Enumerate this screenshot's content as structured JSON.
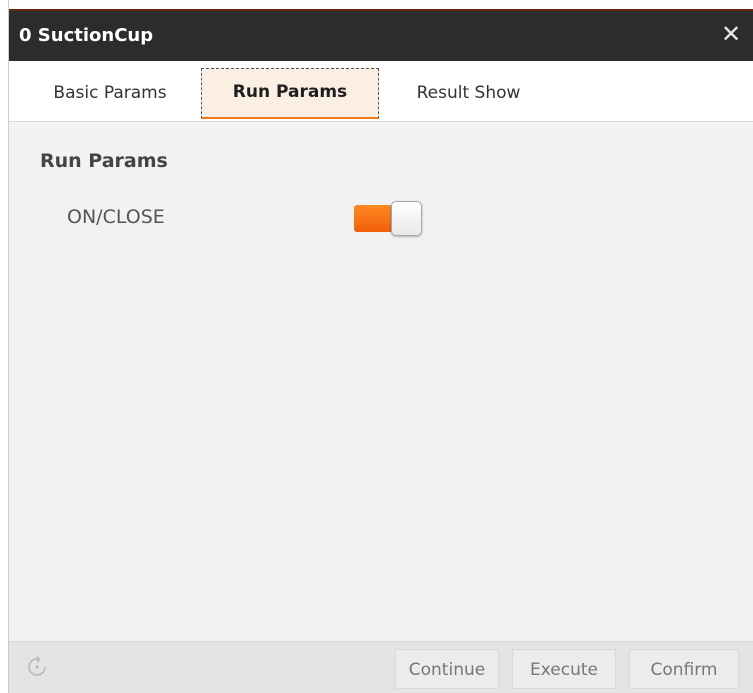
{
  "window": {
    "title": "0 SuctionCup",
    "close_icon": "close-icon"
  },
  "tabs": [
    {
      "label": "Basic Params",
      "active": false
    },
    {
      "label": "Run Params",
      "active": true
    },
    {
      "label": "Result Show",
      "active": false
    }
  ],
  "run_params": {
    "section_title": "Run Params",
    "field": {
      "label": "ON/CLOSE",
      "state": "on",
      "accent_color": "#f47316"
    }
  },
  "footer": {
    "refresh_icon": "refresh-icon",
    "buttons": [
      {
        "label": "Continue"
      },
      {
        "label": "Execute"
      },
      {
        "label": "Confirm"
      }
    ]
  }
}
